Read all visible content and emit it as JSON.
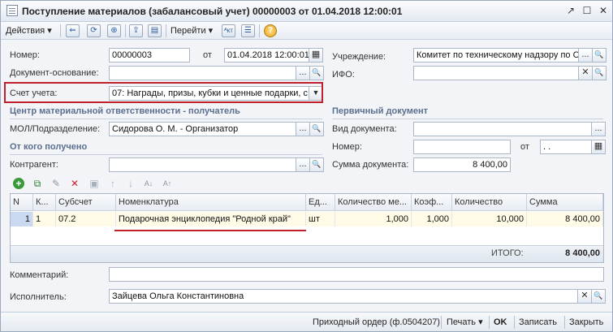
{
  "window": {
    "title": "Поступление материалов (забалансовый учет) 00000003 от 01.04.2018 12:00:01",
    "controls": [
      "↗",
      "☐",
      "✕"
    ]
  },
  "toolbar": {
    "actions_label": "Действия",
    "goto_label": "Перейти",
    "help_glyph": "?",
    "dropdown_arrow": "▾",
    "icon_glyphs": [
      "⇐",
      "⟳",
      "⊕",
      "⇪",
      "▤",
      "ᴬкт",
      "☰"
    ]
  },
  "form": {
    "number_label": "Номер:",
    "number_value": "00000003",
    "from_label": "от",
    "date_value": "01.04.2018 12:00:01",
    "basis_label": "Документ-основание:",
    "basis_value": "",
    "account_label": "Счет учета:",
    "account_value": "07: Награды, призы, кубки и ценные подарки, с",
    "institution_label": "Учреждение:",
    "institution_value": "Комитет по техническому надзору по С",
    "ifo_label": "ИФО:",
    "ifo_value": "",
    "mol_section": "Центр материальной ответственности - получатель",
    "mol_label": "МОЛ/Подразделение:",
    "mol_value": "Сидорова О. М. - Организатор",
    "from_who_section": "От кого получено",
    "counterparty_label": "Контрагент:",
    "counterparty_value": "",
    "primary_doc_section": "Первичный документ",
    "doc_type_label": "Вид документа:",
    "doc_type_value": "",
    "doc_number_label": "Номер:",
    "doc_number_value": "",
    "doc_from_label": "от",
    "doc_date_value": " .  .",
    "doc_sum_label": "Сумма документа:",
    "doc_sum_value": "8 400,00",
    "comment_label": "Комментарий:",
    "comment_value": "",
    "executor_label": "Исполнитель:",
    "executor_value": "Зайцева Ольга Константиновна",
    "ellipsis": "...",
    "search_glyph": "🔍",
    "clear_glyph": "✕",
    "calendar_glyph": "▦",
    "dropdown_glyph": "▼"
  },
  "table_toolbar": {
    "icons": [
      "+",
      "⧉",
      "✎",
      "✕",
      "▣",
      "↑",
      "↓",
      "A↓",
      "A↑"
    ]
  },
  "table": {
    "columns": [
      "N",
      "К...",
      "Субсчет",
      "Номенклатура",
      "Ед...",
      "Количество ме...",
      "Коэф...",
      "Количество",
      "Сумма"
    ],
    "rows": [
      [
        "1",
        "1",
        "07.2",
        "Подарочная энциклопедия \"Родной край\"",
        "шт",
        "1,000",
        "1,000",
        "10,000",
        "8 400,00"
      ]
    ],
    "total_label": "ИТОГО:",
    "total_value": "8 400,00"
  },
  "bottom": {
    "receipt_order": "Приходный ордер (ф.0504207)",
    "print_label": "Печать",
    "ok_label": "OK",
    "save_label": "Записать",
    "close_label": "Закрыть"
  }
}
